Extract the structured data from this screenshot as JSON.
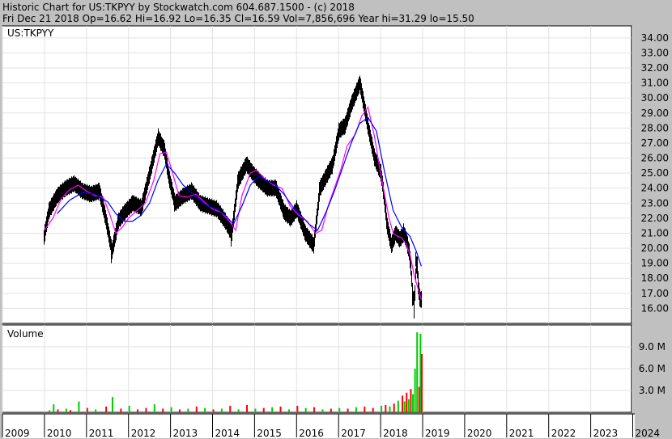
{
  "header": {
    "line1": "Historic Chart for US:TKPYY by Stockwatch.com 604.687.1500 - (c) 2018",
    "line2": "Fri Dec 21 2018   Op=16.62  Hi=16.92  Lo=16.35  Cl=16.59  Vol=7,856,696   Year hi=31.29  lo=15.50"
  },
  "colors": {
    "price_bars": "#000000",
    "ma_short": "#ff00ff",
    "ma_long": "#0000ff",
    "volume_up": "#00cc00",
    "volume_down": "#ff0000"
  },
  "chart_data": [
    {
      "type": "line",
      "title": "US:TKPYY",
      "ylim": [
        15.0,
        34.8
      ],
      "y_ticks": [
        "16.00",
        "17.00",
        "18.00",
        "19.00",
        "20.00",
        "21.00",
        "22.00",
        "23.00",
        "24.00",
        "25.00",
        "26.00",
        "27.00",
        "28.00",
        "29.00",
        "30.00",
        "31.00",
        "32.00",
        "33.00",
        "34.00"
      ],
      "x_ticks": [
        "2009",
        "2010",
        "2011",
        "2012",
        "2013",
        "2014",
        "2015",
        "2016",
        "2017",
        "2018",
        "2019",
        "2020",
        "2021",
        "2022",
        "2023",
        "2024"
      ],
      "series": [
        {
          "style": "daily high-low bars",
          "x": [
            2010.0,
            2010.1,
            2010.3,
            2010.5,
            2010.7,
            2010.9,
            2011.1,
            2011.3,
            2011.45,
            2011.6,
            2011.75,
            2011.9,
            2012.1,
            2012.3,
            2012.5,
            2012.7,
            2012.85,
            2012.95,
            2013.1,
            2013.3,
            2013.5,
            2013.7,
            2013.9,
            2014.1,
            2014.3,
            2014.45,
            2014.6,
            2014.8,
            2014.95,
            2015.1,
            2015.3,
            2015.5,
            2015.7,
            2015.85,
            2016.0,
            2016.2,
            2016.4,
            2016.55,
            2016.7,
            2016.85,
            2017.0,
            2017.15,
            2017.3,
            2017.5,
            2017.7,
            2017.85,
            2018.0,
            2018.05,
            2018.15,
            2018.25,
            2018.35,
            2018.45,
            2018.55,
            2018.62,
            2018.68,
            2018.72,
            2018.76,
            2018.8,
            2018.84,
            2018.88,
            2018.9,
            2018.94,
            2018.97
          ],
          "values": [
            21.0,
            22.5,
            23.5,
            24.0,
            24.3,
            23.8,
            23.6,
            23.8,
            22.0,
            19.8,
            21.8,
            22.4,
            23.0,
            22.7,
            25.0,
            27.4,
            26.5,
            24.8,
            23.0,
            23.5,
            23.8,
            23.0,
            22.8,
            22.6,
            21.8,
            21.0,
            24.5,
            25.6,
            25.0,
            24.5,
            24.0,
            24.0,
            22.4,
            22.0,
            22.6,
            21.0,
            20.2,
            24.0,
            24.8,
            25.6,
            27.8,
            28.2,
            29.6,
            31.0,
            28.0,
            26.0,
            25.0,
            24.0,
            21.5,
            20.2,
            21.0,
            20.6,
            21.0,
            20.4,
            19.6,
            18.4,
            16.7,
            16.59,
            19.0,
            18.2,
            17.2,
            16.59,
            16.59
          ]
        },
        {
          "name": "",
          "style": "short moving average",
          "x": [
            2010.0,
            2010.2,
            2010.4,
            2010.6,
            2010.8,
            2011.0,
            2011.2,
            2011.4,
            2011.55,
            2011.7,
            2011.85,
            2012.0,
            2012.2,
            2012.4,
            2012.6,
            2012.75,
            2012.9,
            2013.05,
            2013.2,
            2013.4,
            2013.6,
            2013.8,
            2014.0,
            2014.2,
            2014.4,
            2014.55,
            2014.7,
            2014.9,
            2015.05,
            2015.25,
            2015.45,
            2015.65,
            2015.85,
            2016.05,
            2016.25,
            2016.45,
            2016.6,
            2016.75,
            2016.9,
            2017.05,
            2017.2,
            2017.4,
            2017.55,
            2017.7,
            2017.85,
            2018.0,
            2018.1,
            2018.2,
            2018.3,
            2018.4,
            2018.5,
            2018.6,
            2018.7,
            2018.8,
            2018.9,
            2018.97
          ],
          "values": [
            21.2,
            22.0,
            23.3,
            23.9,
            24.2,
            23.8,
            23.5,
            23.4,
            22.3,
            21.0,
            21.4,
            22.0,
            22.5,
            23.0,
            24.5,
            26.3,
            26.4,
            25.0,
            23.5,
            23.4,
            23.6,
            23.1,
            22.6,
            22.4,
            21.8,
            21.2,
            23.5,
            25.0,
            25.2,
            24.6,
            24.2,
            24.0,
            22.8,
            22.2,
            21.8,
            21.0,
            21.2,
            22.8,
            24.0,
            25.2,
            26.8,
            27.6,
            28.8,
            29.4,
            27.5,
            25.0,
            23.5,
            22.0,
            21.0,
            20.8,
            20.7,
            20.3,
            19.6,
            18.2,
            17.2,
            16.6
          ]
        },
        {
          "name": "",
          "style": "long moving average",
          "x": [
            2010.3,
            2010.6,
            2010.9,
            2011.2,
            2011.5,
            2011.7,
            2011.9,
            2012.1,
            2012.3,
            2012.5,
            2012.7,
            2012.9,
            2013.1,
            2013.3,
            2013.5,
            2013.7,
            2013.9,
            2014.1,
            2014.3,
            2014.5,
            2014.7,
            2014.9,
            2015.1,
            2015.3,
            2015.5,
            2015.7,
            2015.9,
            2016.1,
            2016.3,
            2016.5,
            2016.7,
            2016.9,
            2017.1,
            2017.3,
            2017.5,
            2017.7,
            2017.9,
            2018.1,
            2018.3,
            2018.5,
            2018.7,
            2018.85,
            2018.97
          ],
          "values": [
            22.3,
            23.2,
            23.7,
            23.6,
            23.1,
            22.3,
            21.8,
            21.8,
            22.2,
            23.0,
            24.5,
            25.6,
            25.0,
            24.2,
            23.7,
            23.2,
            22.8,
            22.6,
            22.2,
            21.6,
            22.8,
            24.2,
            24.8,
            24.5,
            24.2,
            23.6,
            22.8,
            22.2,
            21.6,
            21.2,
            22.4,
            23.8,
            25.4,
            27.0,
            28.3,
            28.7,
            27.8,
            25.0,
            22.5,
            21.4,
            20.8,
            19.8,
            18.8
          ]
        }
      ]
    },
    {
      "type": "bar",
      "title": "Volume",
      "ylim": [
        0,
        12.0
      ],
      "y_unit": "M",
      "y_ticks": [
        "3.0 M",
        "6.0 M",
        "9.0 M"
      ],
      "series": [
        {
          "name": "",
          "x": [
            2010.1,
            2010.2,
            2010.3,
            2010.5,
            2010.6,
            2010.8,
            2011.0,
            2011.2,
            2011.45,
            2011.6,
            2011.8,
            2012.0,
            2012.2,
            2012.4,
            2012.6,
            2012.8,
            2013.0,
            2013.2,
            2013.4,
            2013.6,
            2013.8,
            2014.0,
            2014.2,
            2014.4,
            2014.6,
            2014.8,
            2015.0,
            2015.2,
            2015.4,
            2015.6,
            2015.8,
            2016.0,
            2016.2,
            2016.4,
            2016.6,
            2016.8,
            2017.0,
            2017.2,
            2017.4,
            2017.6,
            2017.8,
            2018.0,
            2018.1,
            2018.2,
            2018.3,
            2018.4,
            2018.5,
            2018.55,
            2018.6,
            2018.65,
            2018.7,
            2018.75,
            2018.8,
            2018.85,
            2018.9,
            2018.93,
            2018.96
          ],
          "values": [
            0.3,
            1.1,
            0.4,
            0.5,
            0.3,
            1.5,
            0.6,
            0.4,
            0.8,
            2.1,
            0.5,
            0.9,
            0.4,
            0.6,
            1.1,
            0.5,
            0.7,
            0.4,
            0.5,
            0.8,
            0.6,
            0.4,
            0.5,
            0.9,
            0.4,
            1.0,
            0.5,
            0.6,
            0.7,
            0.8,
            0.4,
            0.9,
            0.6,
            0.7,
            0.4,
            0.5,
            0.6,
            0.5,
            0.7,
            0.8,
            0.6,
            0.9,
            1.0,
            0.8,
            1.2,
            1.6,
            2.3,
            1.5,
            2.7,
            1.8,
            3.2,
            2.5,
            6.0,
            11.0,
            3.5,
            10.8,
            8.0
          ],
          "direction": [
            "up",
            "up",
            "down",
            "up",
            "down",
            "up",
            "down",
            "up",
            "down",
            "up",
            "down",
            "up",
            "down",
            "down",
            "up",
            "down",
            "up",
            "down",
            "up",
            "down",
            "up",
            "down",
            "up",
            "down",
            "up",
            "down",
            "up",
            "down",
            "up",
            "down",
            "up",
            "down",
            "up",
            "down",
            "up",
            "down",
            "up",
            "down",
            "up",
            "down",
            "down",
            "up",
            "down",
            "up",
            "down",
            "up",
            "down",
            "up",
            "down",
            "up",
            "down",
            "up",
            "up",
            "up",
            "down",
            "up",
            "down"
          ]
        }
      ]
    }
  ]
}
